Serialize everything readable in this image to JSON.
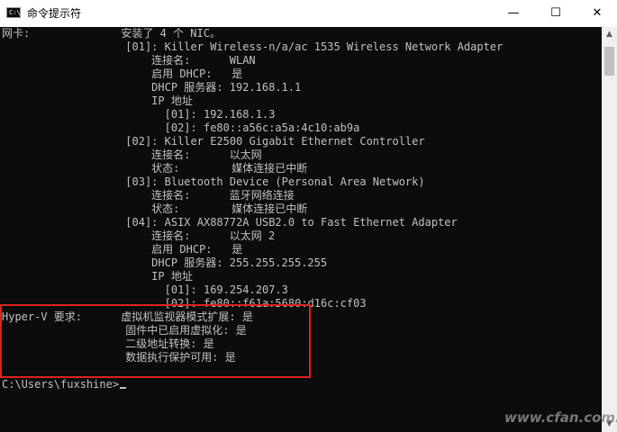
{
  "window": {
    "title": "命令提示符",
    "icon_label": "C:\\_",
    "controls": {
      "minimize": "—",
      "maximize": "☐",
      "close": "✕"
    }
  },
  "console": {
    "lines": [
      "网卡:              安装了 4 个 NIC。",
      "                   [01]: Killer Wireless-n/a/ac 1535 Wireless Network Adapter",
      "                       连接名:      WLAN",
      "                       启用 DHCP:   是",
      "                       DHCP 服务器: 192.168.1.1",
      "                       IP 地址",
      "                         [01]: 192.168.1.3",
      "                         [02]: fe80::a56c:a5a:4c10:ab9a",
      "                   [02]: Killer E2500 Gigabit Ethernet Controller",
      "                       连接名:      以太网",
      "                       状态:        媒体连接已中断",
      "                   [03]: Bluetooth Device (Personal Area Network)",
      "                       连接名:      蓝牙网络连接",
      "                       状态:        媒体连接已中断",
      "                   [04]: ASIX AX88772A USB2.0 to Fast Ethernet Adapter",
      "                       连接名:      以太网 2",
      "                       启用 DHCP:   是",
      "                       DHCP 服务器: 255.255.255.255",
      "                       IP 地址",
      "                         [01]: 169.254.207.3",
      "                         [02]: fe80::f61a:5680:d16c:cf03",
      "Hyper-V 要求:      虚拟机监视器模式扩展: 是",
      "                   固件中已启用虚拟化: 是",
      "                   二级地址转换: 是",
      "                   数据执行保护可用: 是",
      "",
      "C:\\Users\\fuxshine>"
    ]
  },
  "scrollbar": {
    "up_arrow": "▲",
    "down_arrow": "▼"
  },
  "watermark": "www.cfan.com.cn",
  "colors": {
    "console_bg": "#0c0c0c",
    "console_text": "#c0c0c0",
    "highlight": "#e02020"
  }
}
